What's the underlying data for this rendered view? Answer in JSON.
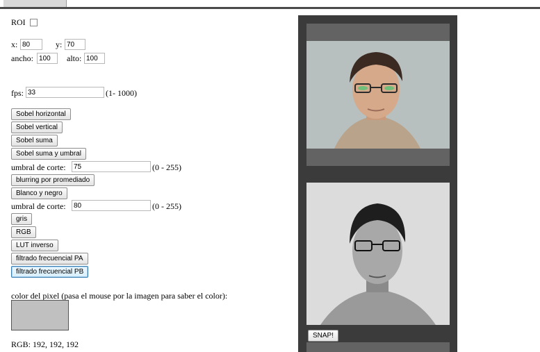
{
  "roi": {
    "label": "ROI",
    "checked": false
  },
  "coords": {
    "x_label": "x:",
    "x_value": "80",
    "y_label": "y:",
    "y_value": "70",
    "ancho_label": "ancho:",
    "ancho_value": "100",
    "alto_label": "alto:",
    "alto_value": "100"
  },
  "fps": {
    "label": "fps:",
    "value": "33",
    "range": "(1- 1000)"
  },
  "buttons": {
    "sobel_h": "Sobel horizontal",
    "sobel_v": "Sobel vertical",
    "sobel_suma": "Sobel suma",
    "sobel_umbral": "Sobel suma y umbral",
    "blurring": "blurring por promediado",
    "bw": "Blanco y negro",
    "gris": "gris",
    "rgb": "RGB",
    "lut": "LUT inverso",
    "pa": "filtrado frecuencial PA",
    "pb": "filtrado frecuencial PB",
    "snap": "SNAP!"
  },
  "umbral1": {
    "label": "umbral de corte:",
    "value": "75",
    "range": "(0 - 255)"
  },
  "umbral2": {
    "label": "umbral de corte:",
    "value": "80",
    "range": "(0 - 255)"
  },
  "pixel": {
    "label": "color del pixel (pasa el mouse por la imagen para saber el color):",
    "rgb_text": "RGB: 192, 192, 192",
    "swatch_color": "#c0c0c0"
  }
}
